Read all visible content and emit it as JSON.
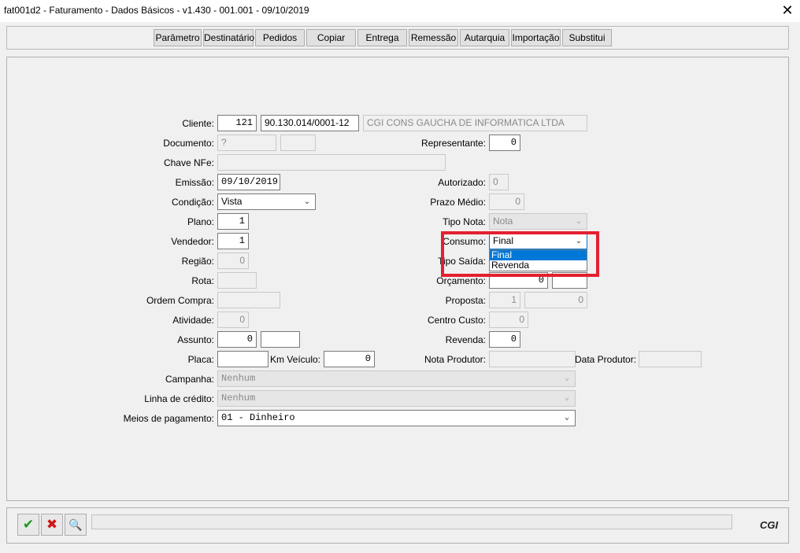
{
  "window": {
    "title": "fat001d2 - Faturamento - Dados Básicos - v1.430 - 001.001 - 09/10/2019",
    "close_glyph": "✕"
  },
  "toolbar": {
    "buttons": [
      "Parâmetro",
      "Destinatário",
      "Pedidos",
      "Copiar",
      "Entrega",
      "Remessão",
      "Autarquia",
      "Importação",
      "Substitui"
    ]
  },
  "form": {
    "cliente": {
      "label": "Cliente:",
      "code": "121",
      "cnpj": "90.130.014/0001-12",
      "name": "CGI CONS GAUCHA DE INFORMATICA LTDA"
    },
    "documento": {
      "label": "Documento:",
      "value": "?",
      "extra": ""
    },
    "chave_nfe": {
      "label": "Chave NFe:",
      "value": ""
    },
    "emissao": {
      "label": "Emissão:",
      "value": "09/10/2019"
    },
    "condicao": {
      "label": "Condição:",
      "value": "Vista"
    },
    "plano": {
      "label": "Plano:",
      "value": "1"
    },
    "vendedor": {
      "label": "Vendedor:",
      "value": "1"
    },
    "regiao": {
      "label": "Região:",
      "value": "0"
    },
    "rota": {
      "label": "Rota:",
      "value": ""
    },
    "ordem_compra": {
      "label": "Ordem Compra:",
      "value": ""
    },
    "atividade": {
      "label": "Atividade:",
      "value": "0"
    },
    "assunto": {
      "label": "Assunto:",
      "value": "0",
      "extra": ""
    },
    "placa": {
      "label": "Placa:",
      "value": ""
    },
    "km_veiculo": {
      "label": "Km Veículo:",
      "value": "0"
    },
    "campanha": {
      "label": "Campanha:",
      "value": "Nenhum"
    },
    "linha_credito": {
      "label": "Linha de crédito:",
      "value": "Nenhum"
    },
    "meios_pagamento": {
      "label": "Meios de pagamento:",
      "value": "01 - Dinheiro"
    },
    "representante": {
      "label": "Representante:",
      "value": "0"
    },
    "autorizado": {
      "label": "Autorizado:",
      "value": "0"
    },
    "prazo_medio": {
      "label": "Prazo Médio:",
      "value": "0"
    },
    "tipo_nota": {
      "label": "Tipo Nota:",
      "value": "Nota"
    },
    "consumo": {
      "label": "Consumo:",
      "value": "Final",
      "options": [
        "Final",
        "Revenda"
      ]
    },
    "tipo_saida": {
      "label": "Tipo Saída:"
    },
    "orcamento": {
      "label": "Orçamento:",
      "value": "0",
      "extra": ""
    },
    "proposta": {
      "label": "Proposta:",
      "value": "1",
      "extra": "0"
    },
    "centro_custo": {
      "label": "Centro Custo:",
      "value": "0"
    },
    "revenda": {
      "label": "Revenda:",
      "value": "0"
    },
    "nota_produtor": {
      "label": "Nota Produtor:",
      "value": ""
    },
    "data_produtor": {
      "label": "Data Produtor:",
      "value": ""
    }
  },
  "footer": {
    "confirm_glyph": "✔",
    "cancel_glyph": "✖",
    "search_glyph": "🔍",
    "status_text": "",
    "logo": "CGI"
  },
  "colors": {
    "highlight": "#e32030",
    "selection": "#0078d7",
    "confirm": "#1a9a1a",
    "cancel": "#d01818"
  }
}
